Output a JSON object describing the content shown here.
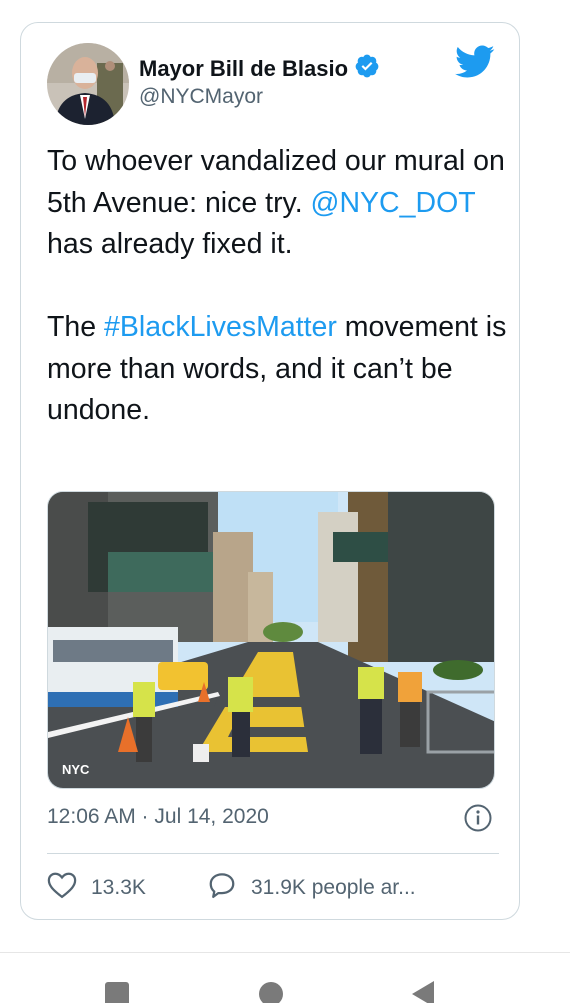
{
  "tweet": {
    "author_name": "Mayor Bill de Blasio",
    "handle": "@NYCMayor",
    "text_line1_segments": [
      "To whoever vandalized our mural on 5th Avenue: nice try."
    ],
    "mention": "@NYC_DOT",
    "text_after_mention": " has already fixed it.",
    "text_before_hashtag": "The ",
    "hashtag": "#BlackLivesMatter",
    "text_after_hashtag": " movement is more than words, and it can’t be undone.",
    "media_watermark": "NYC",
    "timestamp": "12:06 AM · Jul 14, 2020",
    "likes_count": "13.3K",
    "replies_label": "31.9K people ar..."
  },
  "icons": {
    "verified": "verified-badge-icon",
    "brand": "twitter-bird-icon",
    "info": "info-icon",
    "like": "heart-icon",
    "reply": "speech-bubble-icon"
  },
  "colors": {
    "brand_blue": "#1d9bf0",
    "text": "#0f1419",
    "secondary": "#536471",
    "border": "#cfd9de"
  }
}
